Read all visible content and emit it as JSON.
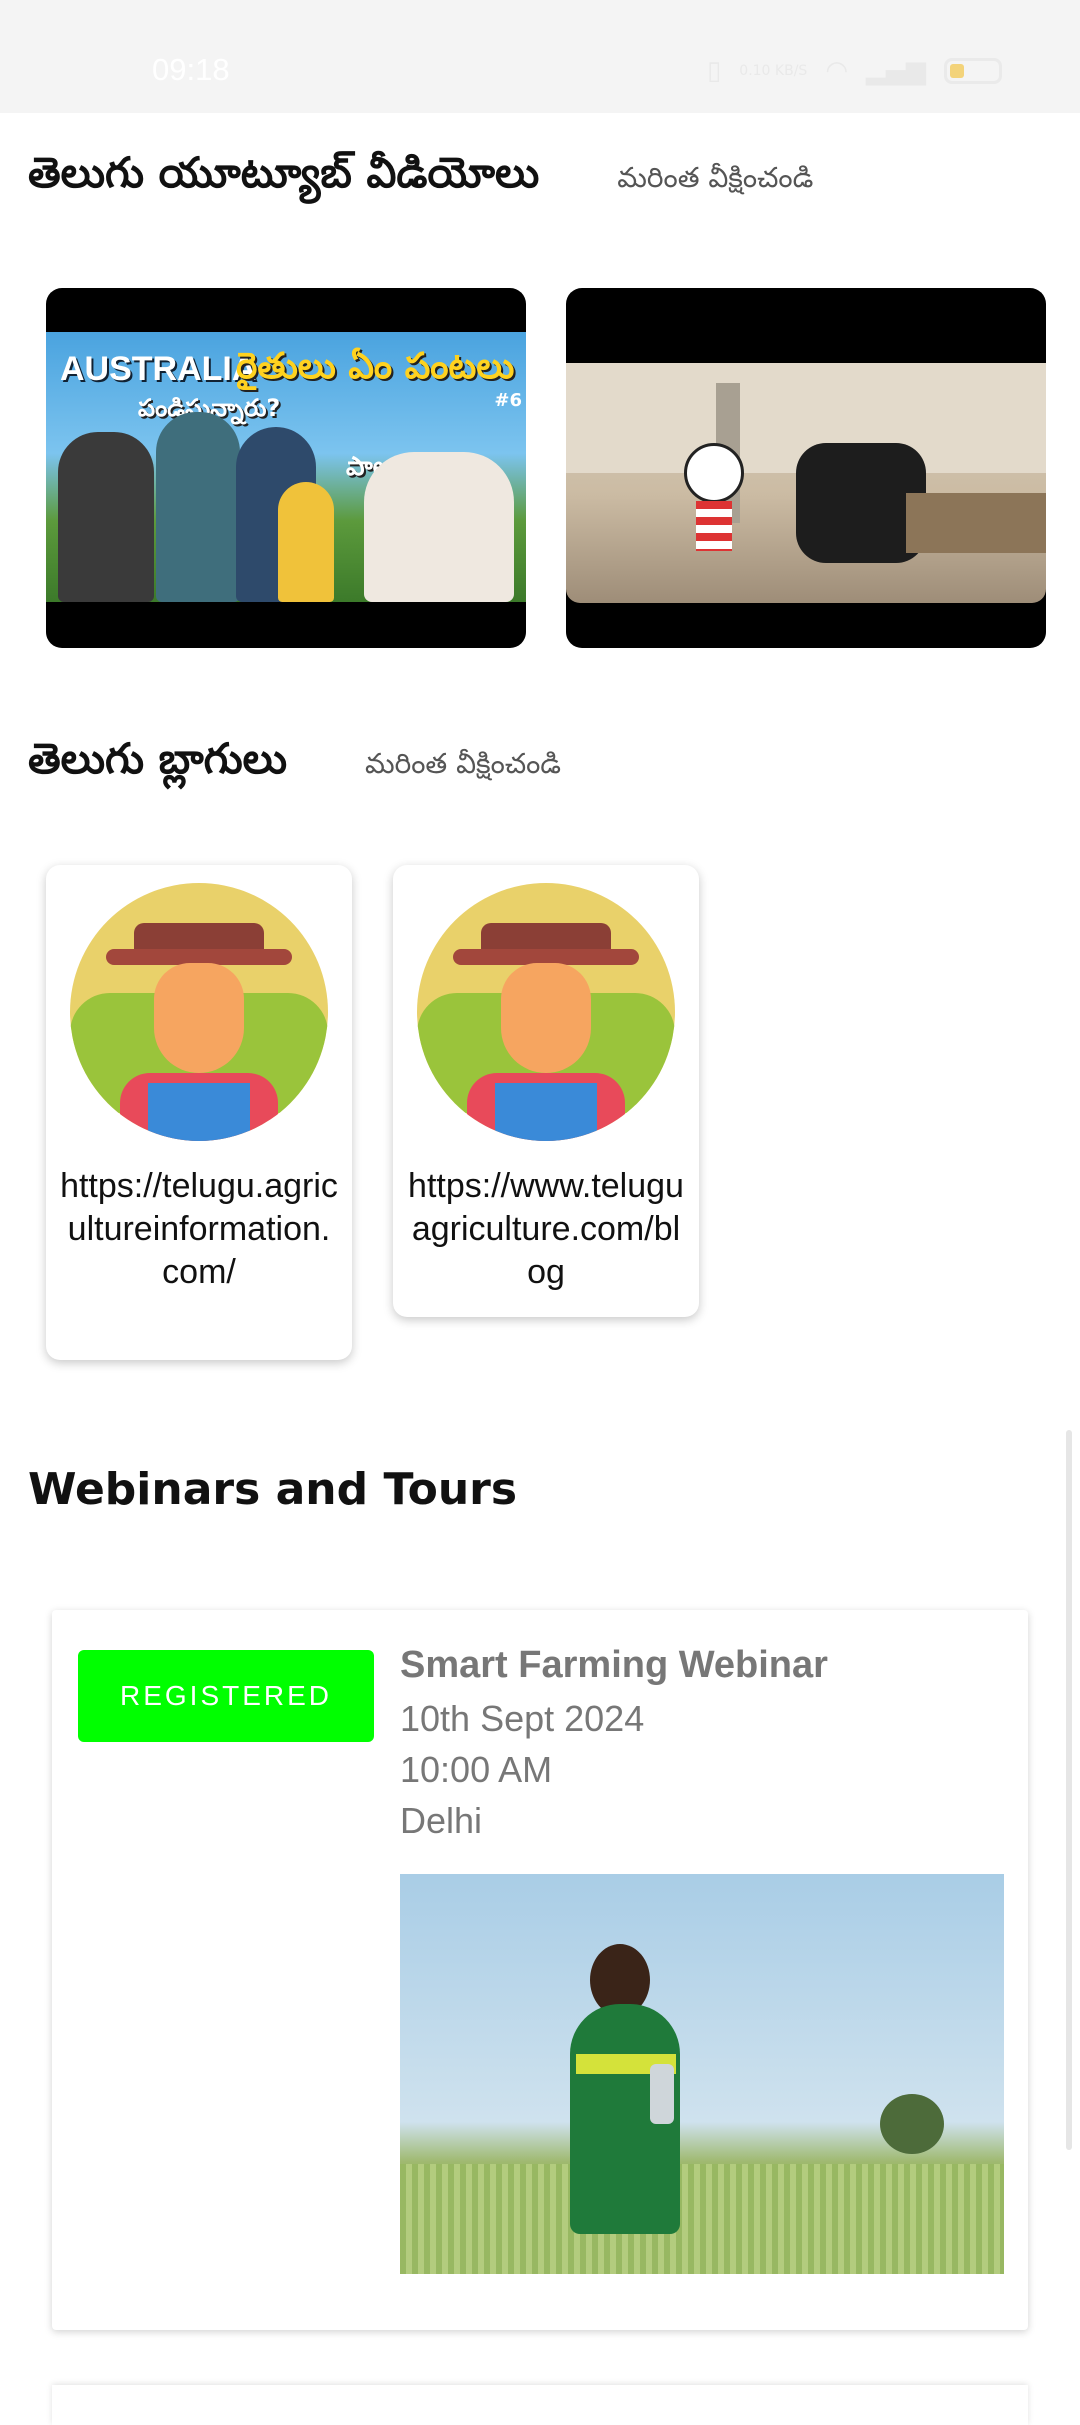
{
  "status_bar": {
    "time": "09:18",
    "data_speed": "0.10 KB/S",
    "battery_level": "21"
  },
  "youtube_section": {
    "title": "తెలుగు యూట్యూబ్ వీడియోలు",
    "see_more": "మరింత వీక్షించండి",
    "videos": [
      {
        "title_en": "AUSTRALIA",
        "title_te": "రైతులు ఏం పంటలు",
        "subtitle": "పండిస్తున్నారు?",
        "extra": "పాలు ఎంత?",
        "badge": "#6"
      },
      {
        "description": "cartoon-video"
      }
    ]
  },
  "blogs_section": {
    "title": "తెలుగు బ్లాగులు",
    "see_more": "మరింత వీక్షించండి",
    "blogs": [
      {
        "url": "https://telugu.agricultureinformation.com/"
      },
      {
        "url": "https://www.teluguagriculture.com/blog"
      }
    ]
  },
  "webinars_section": {
    "title": "Webinars and Tours",
    "webinar": {
      "status": "REGISTERED",
      "title": "Smart Farming Webinar",
      "date": "10th Sept 2024",
      "time": "10:00 AM",
      "location": "Delhi"
    }
  },
  "colors": {
    "registered_badge": "#00ff00",
    "muted_text": "#777777"
  }
}
